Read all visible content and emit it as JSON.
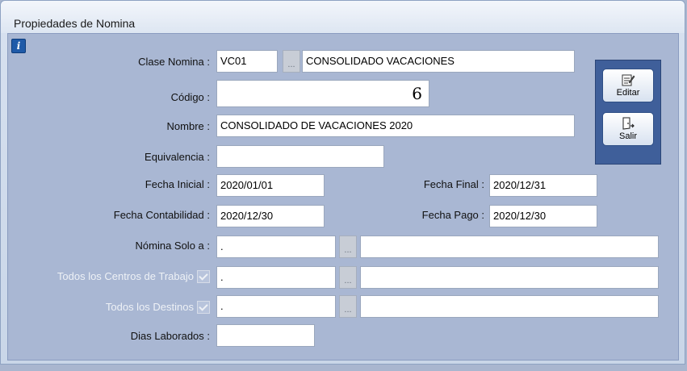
{
  "window": {
    "title": "Propiedades de Nomina"
  },
  "toolbar": {
    "edit_label": "Editar",
    "exit_label": "Salir"
  },
  "form": {
    "clase_nomina": {
      "label": "Clase Nomina :",
      "code": "VC01",
      "lookup": "...",
      "description": "CONSOLIDADO VACACIONES"
    },
    "codigo": {
      "label": "Código :",
      "value": "6"
    },
    "nombre": {
      "label": "Nombre :",
      "value": "CONSOLIDADO DE VACACIONES 2020"
    },
    "equivalencia": {
      "label": "Equivalencia :",
      "value": ""
    },
    "fecha_inicial": {
      "label": "Fecha Inicial :",
      "value": "2020/01/01"
    },
    "fecha_final": {
      "label": "Fecha Final :",
      "value": "2020/12/31"
    },
    "fecha_contabilidad": {
      "label": "Fecha Contabilidad :",
      "value": "2020/12/30"
    },
    "fecha_pago": {
      "label": "Fecha Pago :",
      "value": "2020/12/30"
    },
    "nomina_solo_a": {
      "label": "Nómina Solo a :",
      "code": ".",
      "lookup": "...",
      "description": ""
    },
    "centros_trabajo": {
      "label": "Todos los Centros de Trabajo",
      "code": ".",
      "lookup": "...",
      "description": ""
    },
    "destinos": {
      "label": "Todos los Destinos",
      "code": ".",
      "lookup": "...",
      "description": ""
    },
    "dias_laborados": {
      "label": "Dias Laborados :",
      "value": ""
    }
  },
  "colors": {
    "panel": "#a9b7d3",
    "toolbar": "#3f5f9a",
    "field": "#ffffff"
  }
}
